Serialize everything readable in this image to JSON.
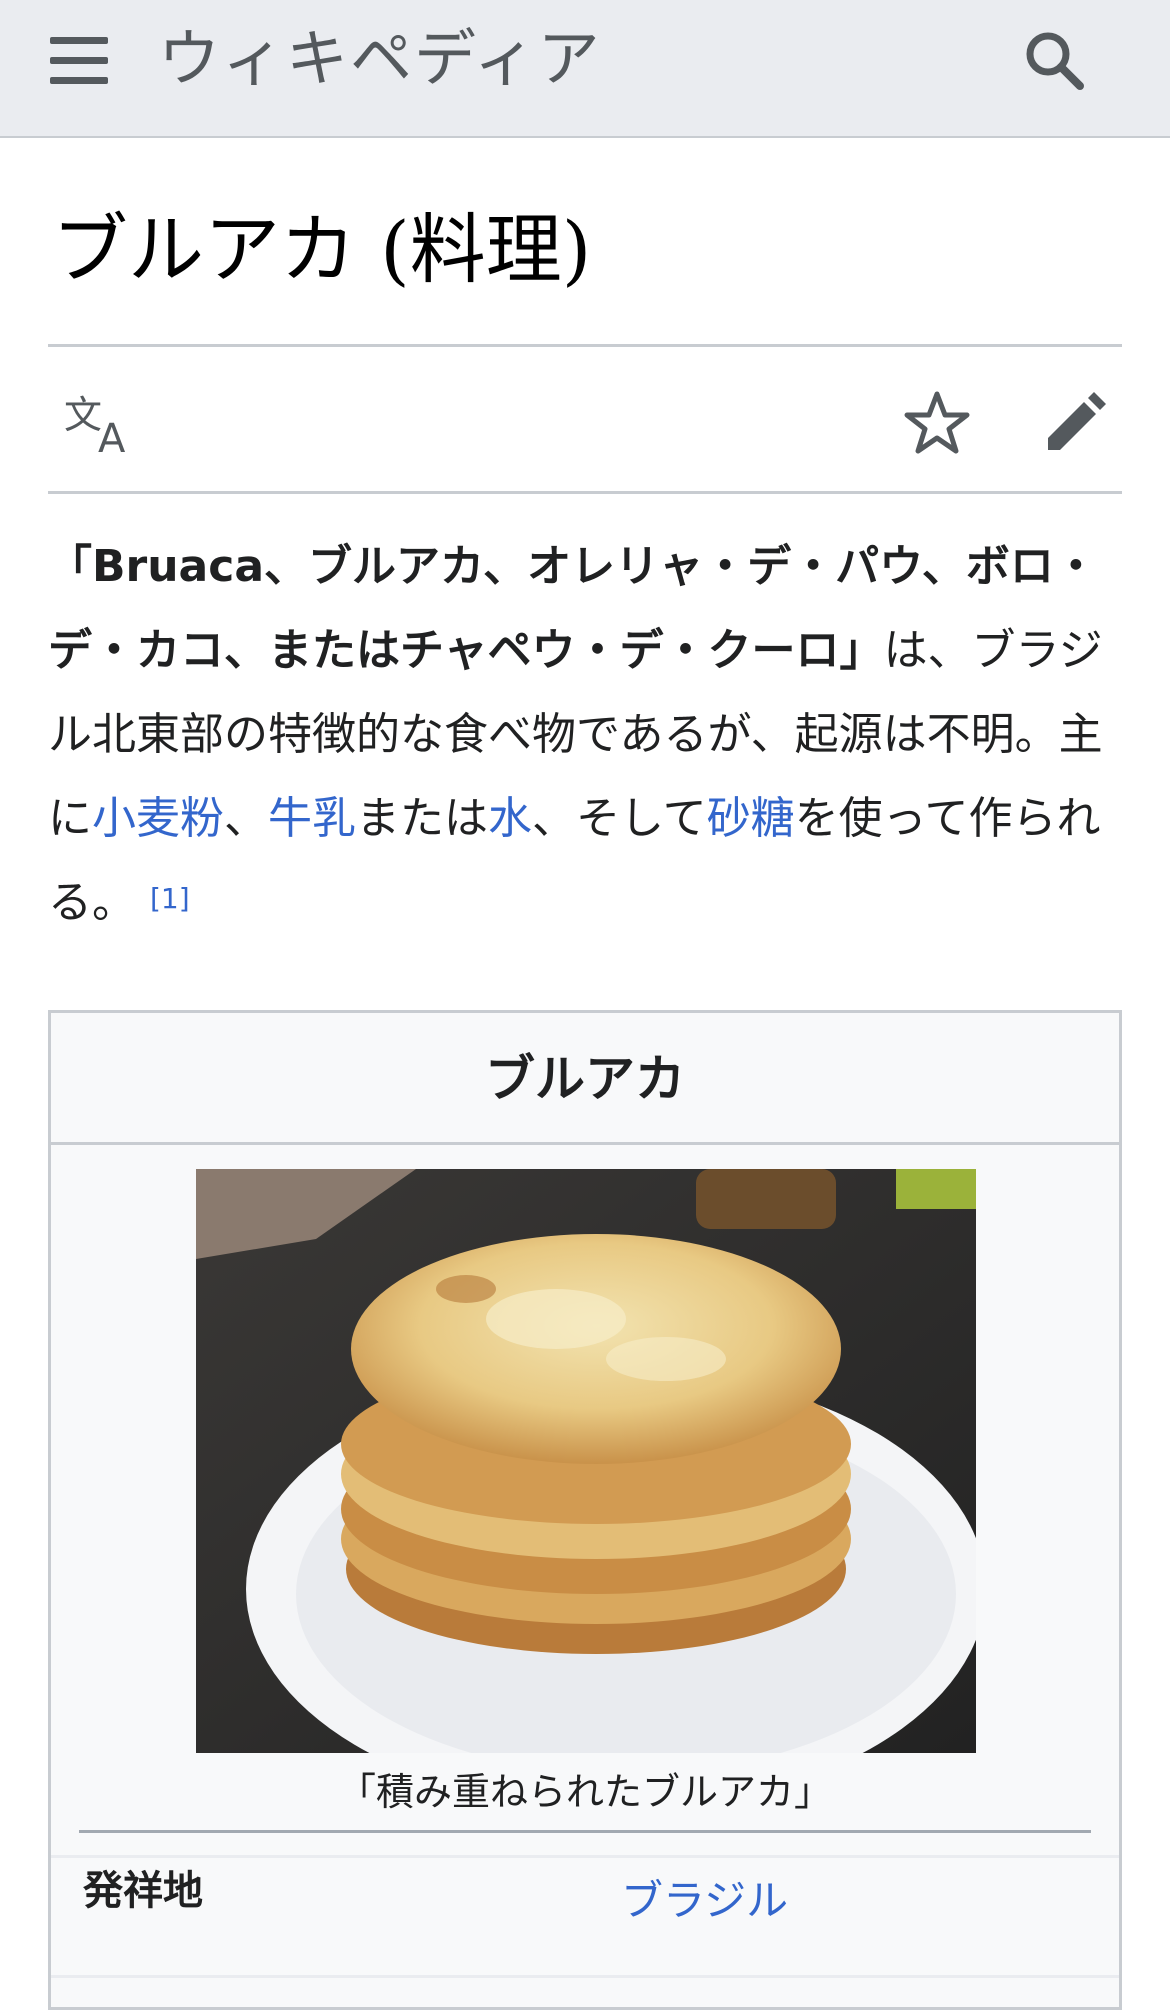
{
  "header": {
    "wordmark": "ウィキペディア",
    "menu_icon": "hamburger-menu-icon",
    "search_icon": "search-icon"
  },
  "page": {
    "title": "ブルアカ (料理)"
  },
  "actions": {
    "language_icon": "translate-icon",
    "watch_icon": "star-icon",
    "edit_icon": "pencil-icon"
  },
  "lead": {
    "bold": "「Bruaca、ブルアカ、オレリャ・デ・パウ、ボロ・デ・カコ、またはチャペウ・デ・クーロ」",
    "text1": "は、ブラジル北東部の特徴的な食べ物であるが、起源は不明。主に",
    "link_flour": "小麦粉",
    "sep1": "、",
    "link_milk": "牛乳",
    "text2": "または",
    "link_water": "水",
    "text3": "、そして",
    "link_sugar": "砂糖",
    "text4": "を使って作られる。",
    "ref": "[1]"
  },
  "infobox": {
    "title": "ブルアカ",
    "caption": "「積み重ねられたブルアカ」",
    "rows": [
      {
        "label": "発祥地",
        "value": "ブラジル"
      }
    ]
  },
  "colors": {
    "header_bg": "#eaecf0",
    "link": "#3366cc",
    "border": "#c8ccd1",
    "icon": "#54595d"
  }
}
